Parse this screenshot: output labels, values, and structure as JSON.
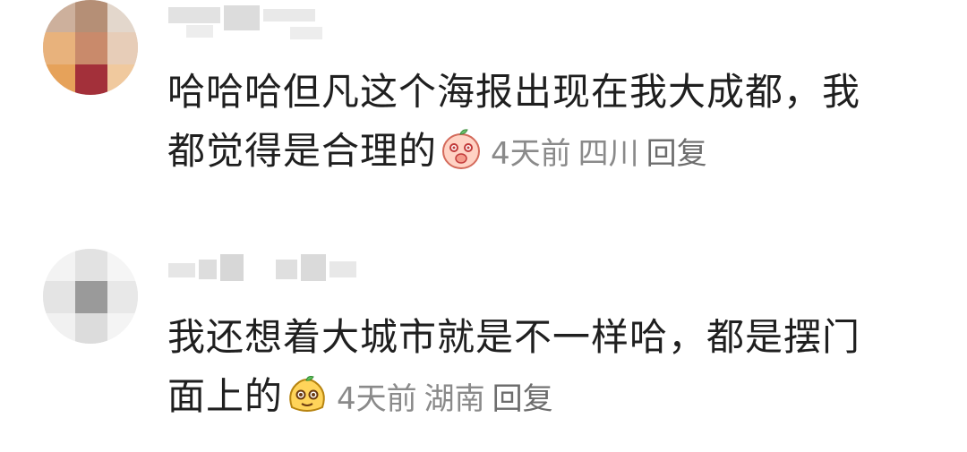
{
  "comments": [
    {
      "text_line1": "哈哈哈但凡这个海报出现在我大成都，我",
      "text_line2": "都觉得是合理的",
      "sticker": "peach-face-sticker",
      "time": "4天前",
      "location": "四川",
      "reply_label": "回复"
    },
    {
      "text_line1": "我还想着大城市就是不一样哈，都是摆门",
      "text_line2": "面上的",
      "sticker": "yellow-blob-sticker",
      "time": "4天前",
      "location": "湖南",
      "reply_label": "回复"
    }
  ],
  "colors": {
    "text": "#1f1f1f",
    "meta": "#8a8a8a",
    "background": "#ffffff"
  }
}
